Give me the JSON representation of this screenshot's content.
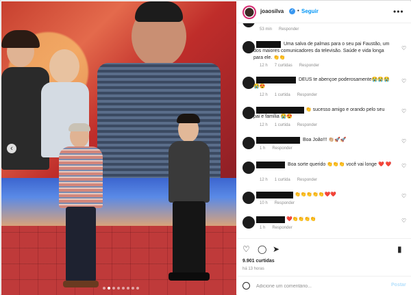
{
  "header": {
    "username": "joaosilva",
    "separator": "•",
    "follow_label": "Seguir",
    "more_icon": "more-horizontal-icon"
  },
  "comments": [
    {
      "text": "",
      "meta": [
        "53 min",
        "Responder"
      ]
    },
    {
      "text": "Uma salva de palmas para o seu pai Faustão, um dos maiores comunicadores da televisão. Saúde e vida longa para ele. 👏👏",
      "meta": [
        "12 h",
        "7 curtidas",
        "Responder"
      ]
    },
    {
      "text": "DEUS te abençoe poderosamente😭😭😭😭😍",
      "meta": [
        "12 h",
        "1 curtida",
        "Responder"
      ]
    },
    {
      "text": "👏 sucesso amigo e orando pelo seu pai e família 😭😍",
      "meta": [
        "12 h",
        "1 curtida",
        "Responder"
      ]
    },
    {
      "text": "Boa João!!! 👏🏼🚀🚀",
      "meta": [
        "1 h",
        "Responder"
      ]
    },
    {
      "text": "Boa sorte querido 👏👏👏 você vai longe ❤️ ❤️",
      "meta": [
        "12 h",
        "1 curtida",
        "Responder"
      ]
    },
    {
      "text": "👏👏👏👏👏❤️❤️",
      "meta": [
        "10 h",
        "Responder"
      ]
    },
    {
      "text": "❤️👏👏👏👏",
      "meta": [
        "1 h",
        "Responder"
      ]
    }
  ],
  "actions": {
    "like_icon": "heart-icon",
    "comment_icon": "comment-icon",
    "share_icon": "share-icon",
    "save_icon": "bookmark-icon"
  },
  "likes_label": "9.901 curtidas",
  "time_label": "há 13 horas",
  "add_comment": {
    "placeholder": "Adicione um comentário...",
    "post_label": "Postar"
  },
  "carousel": {
    "prev_icon": "chevron-left-icon",
    "total": 8,
    "active": 1
  },
  "colors": {
    "accent": "#0095f6",
    "verified": "#3897f0"
  }
}
